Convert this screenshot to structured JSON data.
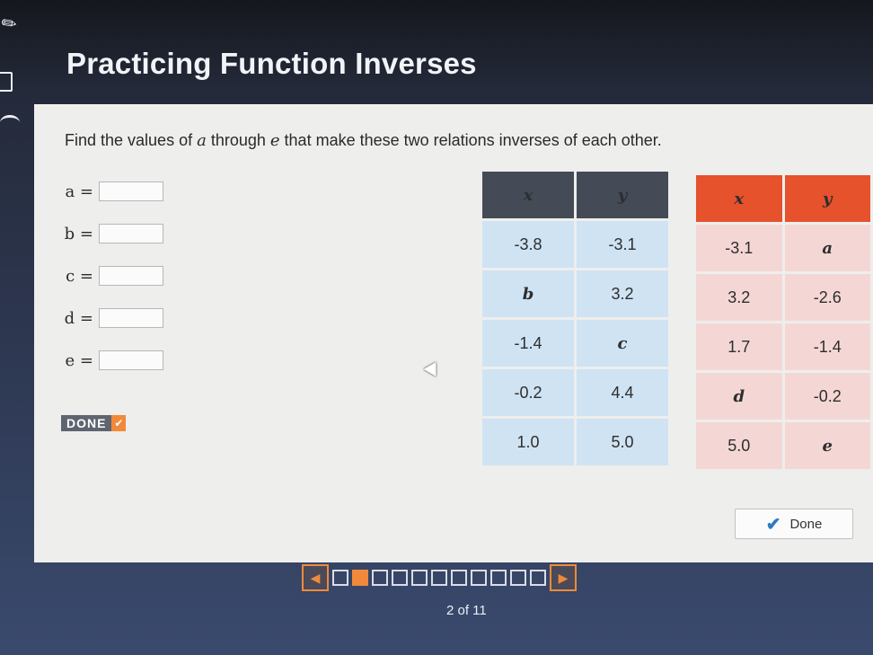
{
  "app": {
    "title": "Practicing Function Inverses"
  },
  "question": {
    "prompt_prefix": "Find the values of ",
    "var_a": "a",
    "prompt_mid": " through ",
    "var_e": "e",
    "prompt_suffix": " that make these two relations inverses of each other."
  },
  "answers": [
    {
      "label": "a =",
      "value": ""
    },
    {
      "label": "b =",
      "value": ""
    },
    {
      "label": "c =",
      "value": ""
    },
    {
      "label": "d =",
      "value": ""
    },
    {
      "label": "e =",
      "value": ""
    }
  ],
  "done_mini": {
    "label": "DONE",
    "icon": "check-icon"
  },
  "table1": {
    "headers": [
      "x",
      "y"
    ],
    "rows": [
      [
        "-3.8",
        "-3.1"
      ],
      [
        "b",
        "3.2"
      ],
      [
        "-1.4",
        "c"
      ],
      [
        "-0.2",
        "4.4"
      ],
      [
        "1.0",
        "5.0"
      ]
    ]
  },
  "table2": {
    "headers": [
      "x",
      "y"
    ],
    "rows": [
      [
        "-3.1",
        "a"
      ],
      [
        "3.2",
        "-2.6"
      ],
      [
        "1.7",
        "-1.4"
      ],
      [
        "d",
        "-0.2"
      ],
      [
        "5.0",
        "e"
      ]
    ]
  },
  "done_button": {
    "label": "Done",
    "icon": "check-icon"
  },
  "pager": {
    "text": "2 of 11",
    "current": 2,
    "total": 11
  },
  "colors": {
    "accent": "#f08a3a",
    "table1_header": "#444b56",
    "table2_header": "#e5522c"
  }
}
